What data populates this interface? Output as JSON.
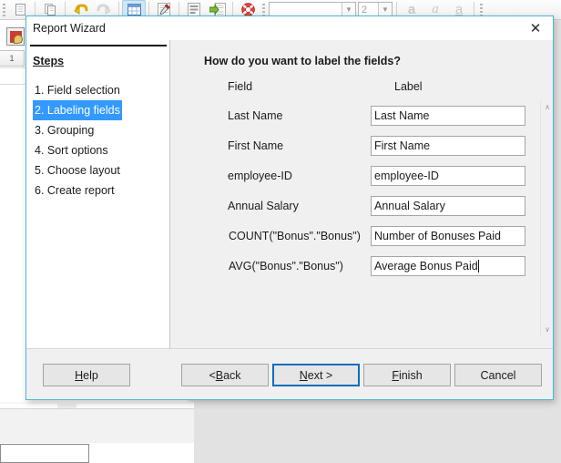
{
  "app": {
    "toolbar": {
      "items": [
        {
          "name": "new-icon",
          "glyph": "▤"
        },
        {
          "name": "copy-icon",
          "glyph": "❐"
        },
        {
          "name": "undo-icon",
          "glyph": "↶"
        },
        {
          "name": "redo-icon",
          "glyph": "↷"
        },
        {
          "name": "table-view-icon",
          "glyph": "▦"
        },
        {
          "name": "form-design-icon",
          "glyph": "✎"
        },
        {
          "name": "align-icon",
          "glyph": "≡"
        },
        {
          "name": "export-icon",
          "glyph": "➡"
        },
        {
          "name": "help-icon",
          "glyph": "☉"
        }
      ],
      "font_name_value": "",
      "font_name_placeholder": "",
      "font_size_value": "2",
      "bold_label": "a",
      "italic_label": "a",
      "underline_label": "a"
    },
    "background": {
      "row_header_label": "1"
    }
  },
  "dialog": {
    "title": "Report Wizard",
    "close_label": "✕",
    "steps": {
      "title": "Steps",
      "items": [
        {
          "label": "1. Field selection",
          "selected": false
        },
        {
          "label": "2. Labeling fields",
          "selected": true
        },
        {
          "label": "3. Grouping",
          "selected": false
        },
        {
          "label": "4. Sort options",
          "selected": false
        },
        {
          "label": "5. Choose layout",
          "selected": false
        },
        {
          "label": "6. Create report",
          "selected": false
        }
      ]
    },
    "content": {
      "heading": "How do you want to label the fields?",
      "column_field": "Field",
      "column_label": "Label",
      "rows": [
        {
          "field": "Last Name",
          "label": "Last Name",
          "indented": false,
          "focused": false
        },
        {
          "field": "First Name",
          "label": "First Name",
          "indented": false,
          "focused": false
        },
        {
          "field": "employee-ID",
          "label": "employee-ID",
          "indented": false,
          "focused": false
        },
        {
          "field": "Annual Salary",
          "label": "Annual Salary",
          "indented": false,
          "focused": false
        },
        {
          "field": "COUNT(\"Bonus\".\"Bonus\")",
          "label": "Number of Bonuses Paid",
          "indented": true,
          "focused": false
        },
        {
          "field": "AVG(\"Bonus\".\"Bonus\")",
          "label": "Average Bonus Paid",
          "indented": true,
          "focused": true
        }
      ],
      "scroll_up_glyph": "∧",
      "scroll_down_glyph": "∨"
    },
    "footer": {
      "help": {
        "pre": "",
        "mn": "H",
        "post": "elp"
      },
      "back": {
        "pre": "< ",
        "mn": "B",
        "post": "ack"
      },
      "next": {
        "pre": "",
        "mn": "N",
        "post": "ext >"
      },
      "finish": {
        "pre": "",
        "mn": "F",
        "post": "inish"
      },
      "cancel": {
        "pre": "",
        "mn": "",
        "post": "Cancel"
      }
    }
  },
  "colors": {
    "selection_blue": "#3399ff",
    "focus_blue": "#0a6ebd",
    "dialog_border": "#4cb8d4",
    "dialog_bg": "#f0f0f0"
  }
}
